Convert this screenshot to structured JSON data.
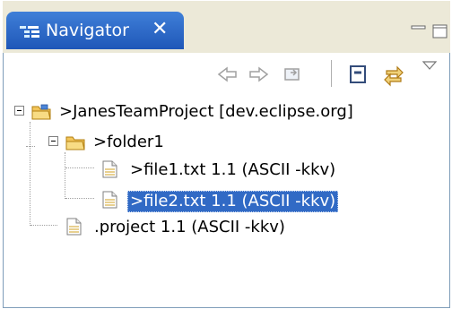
{
  "view": {
    "tab_label": "Navigator",
    "close_symbol": "✕",
    "icons": {
      "tab": "navigator-tab-icon",
      "close": "close-icon",
      "minimize": "minimize-icon",
      "maximize": "maximize-icon"
    }
  },
  "toolbar": {
    "buttons": [
      {
        "name": "back-icon"
      },
      {
        "name": "forward-icon"
      },
      {
        "name": "go-into-icon"
      },
      {
        "name": "collapse-all-icon"
      },
      {
        "name": "link-with-editor-icon"
      },
      {
        "name": "view-menu-icon"
      }
    ]
  },
  "tree": {
    "project": {
      "label": ">JanesTeamProject  [dev.eclipse.org]",
      "icon": "project-folder-icon"
    },
    "folder": {
      "label": ">folder1",
      "icon": "folder-icon"
    },
    "file1": {
      "label": ">file1.txt  1.1  (ASCII -kkv)",
      "icon": "text-file-icon"
    },
    "file2": {
      "label": ">file2.txt  1.1  (ASCII -kkv)",
      "icon": "text-file-icon",
      "selected": true
    },
    "project_file": {
      "label": ".project  1.1  (ASCII -kkv)",
      "icon": "text-file-icon"
    }
  },
  "colors": {
    "tab_active": "#2a63c8",
    "selection": "#316ac5",
    "border": "#7f9db9"
  }
}
